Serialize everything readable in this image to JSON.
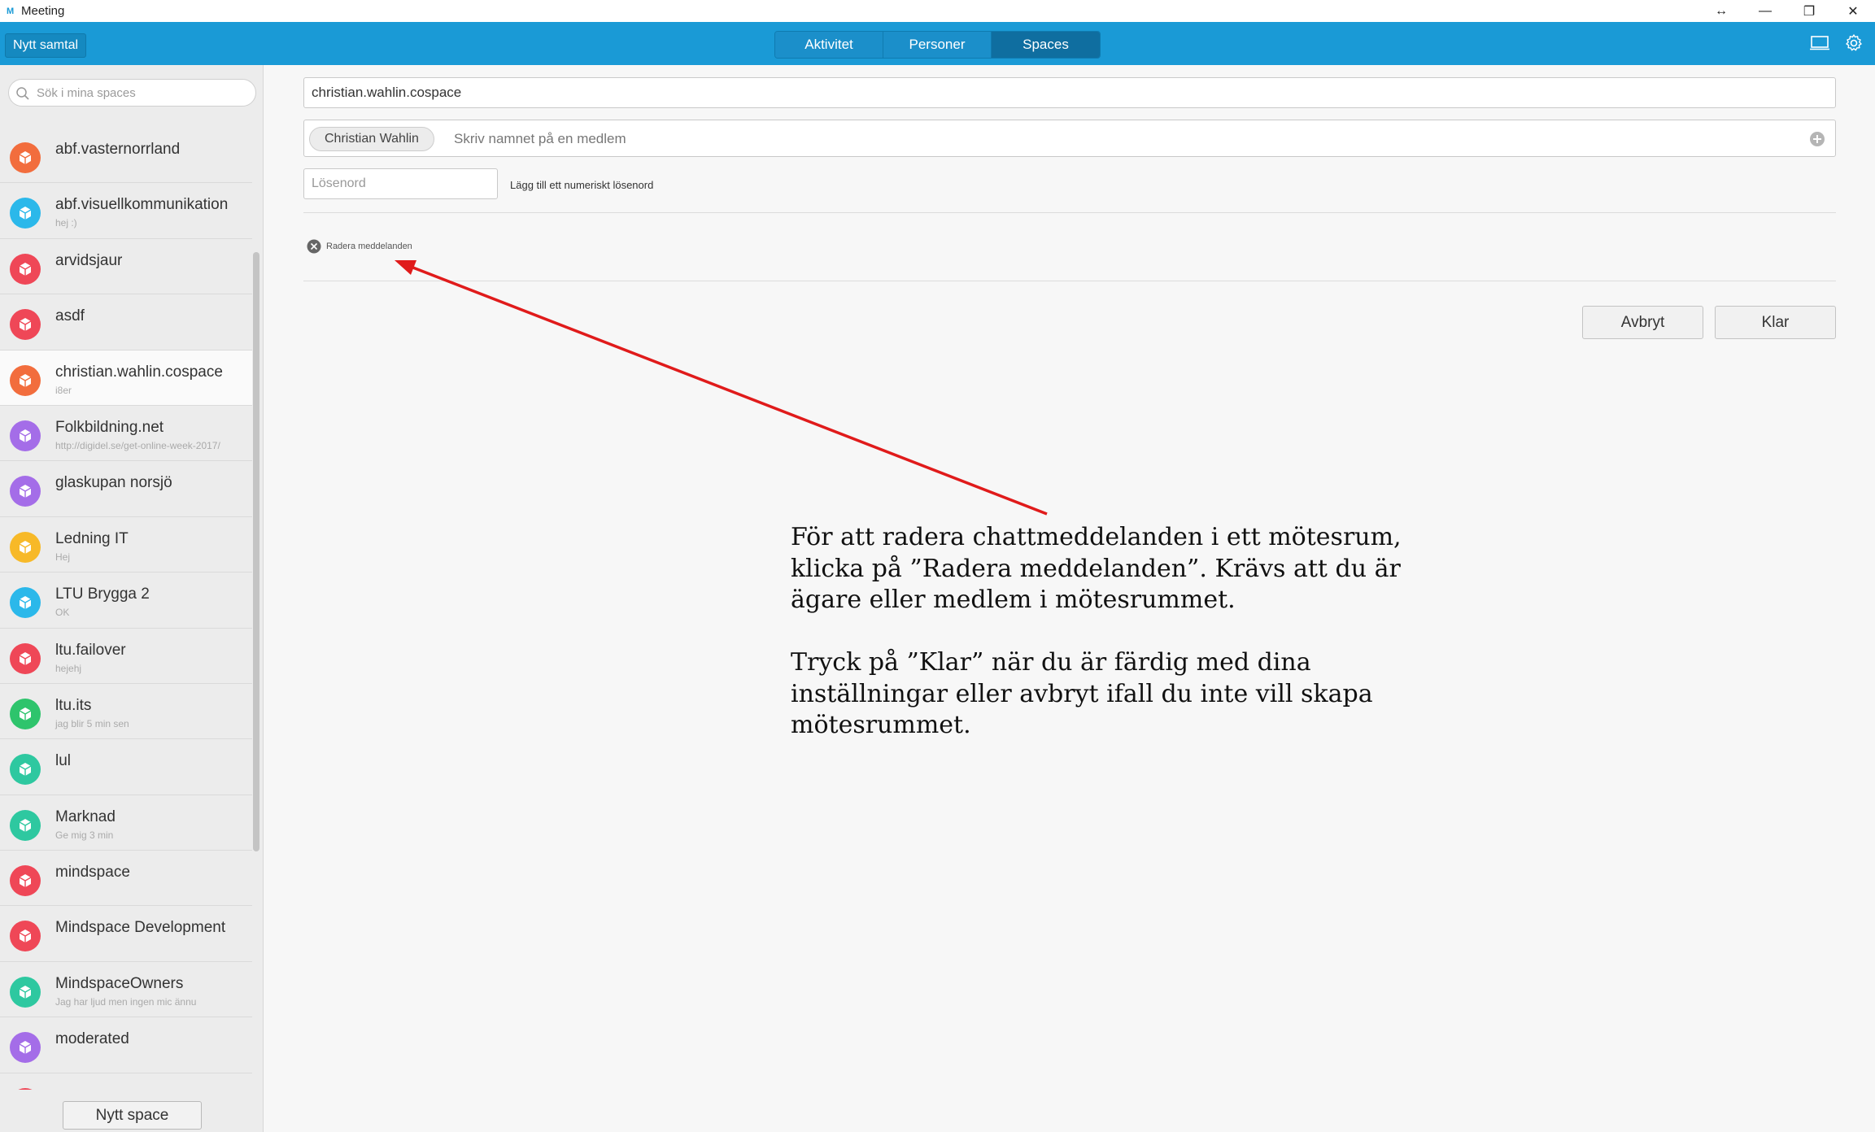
{
  "window": {
    "title": "Meeting",
    "logo_text": "M",
    "controls": [
      "↔",
      "—",
      "❐",
      "✕"
    ]
  },
  "topbar": {
    "new_call_label": "Nytt samtal",
    "tabs": [
      {
        "label": "Aktivitet",
        "active": false
      },
      {
        "label": "Personer",
        "active": false
      },
      {
        "label": "Spaces",
        "active": true
      }
    ],
    "icons": [
      "monitor-icon",
      "gear-icon"
    ]
  },
  "sidebar": {
    "search_placeholder": "Sök i mina spaces",
    "new_space_label": "Nytt space",
    "spaces": [
      {
        "name": "abf.vasternorrland",
        "sub": "",
        "color": "#f26d3d"
      },
      {
        "name": "abf.visuellkommunikation",
        "sub": "hej :)",
        "color": "#2bb8ea"
      },
      {
        "name": "arvidsjaur",
        "sub": "",
        "color": "#ef4757"
      },
      {
        "name": "asdf",
        "sub": "",
        "color": "#ef4757"
      },
      {
        "name": "christian.wahlin.cospace",
        "sub": "i8er",
        "color": "#f26d3d",
        "selected": true
      },
      {
        "name": "Folkbildning.net",
        "sub": "http://digidel.se/get-online-week-2017/",
        "color": "#a46de8"
      },
      {
        "name": "glaskupan norsjö",
        "sub": "",
        "color": "#a46de8"
      },
      {
        "name": "Ledning IT",
        "sub": "Hej",
        "color": "#f7b928"
      },
      {
        "name": "LTU Brygga 2",
        "sub": "OK",
        "color": "#2bb8ea"
      },
      {
        "name": "ltu.failover",
        "sub": "hejehj",
        "color": "#ef4757"
      },
      {
        "name": "ltu.its",
        "sub": "jag blir 5 min sen",
        "color": "#2ec46c"
      },
      {
        "name": "lul",
        "sub": "",
        "color": "#2ec8a0"
      },
      {
        "name": "Marknad",
        "sub": "Ge mig 3 min",
        "color": "#2ec8a0"
      },
      {
        "name": "mindspace",
        "sub": "",
        "color": "#ef4757"
      },
      {
        "name": "Mindspace Development",
        "sub": "",
        "color": "#ef4757"
      },
      {
        "name": "MindspaceOwners",
        "sub": "Jag har ljud men ingen mic ännu",
        "color": "#2ec8a0"
      },
      {
        "name": "moderated",
        "sub": "",
        "color": "#a46de8"
      },
      {
        "name": "",
        "sub": "",
        "color": "#ef4757"
      }
    ]
  },
  "form": {
    "space_name_value": "christian.wahlin.cospace",
    "member_chip": "Christian Wahlin",
    "member_placeholder": "Skriv namnet på en medlem",
    "password_placeholder": "Lösenord",
    "password_hint": "Lägg till ett numeriskt lösenord",
    "delete_messages_label": "Radera meddelanden",
    "cancel_label": "Avbryt",
    "done_label": "Klar"
  },
  "annotation": {
    "arrow_color": "#e01b1b",
    "paragraph1": "För att radera chattmeddelanden i ett mötesrum, klicka på ”Radera meddelanden”. Krävs att du är ägare eller medlem i mötesrummet.",
    "paragraph2": "Tryck på ”Klar” när du är färdig med dina inställningar eller avbryt ifall du inte vill skapa mötesrummet."
  }
}
